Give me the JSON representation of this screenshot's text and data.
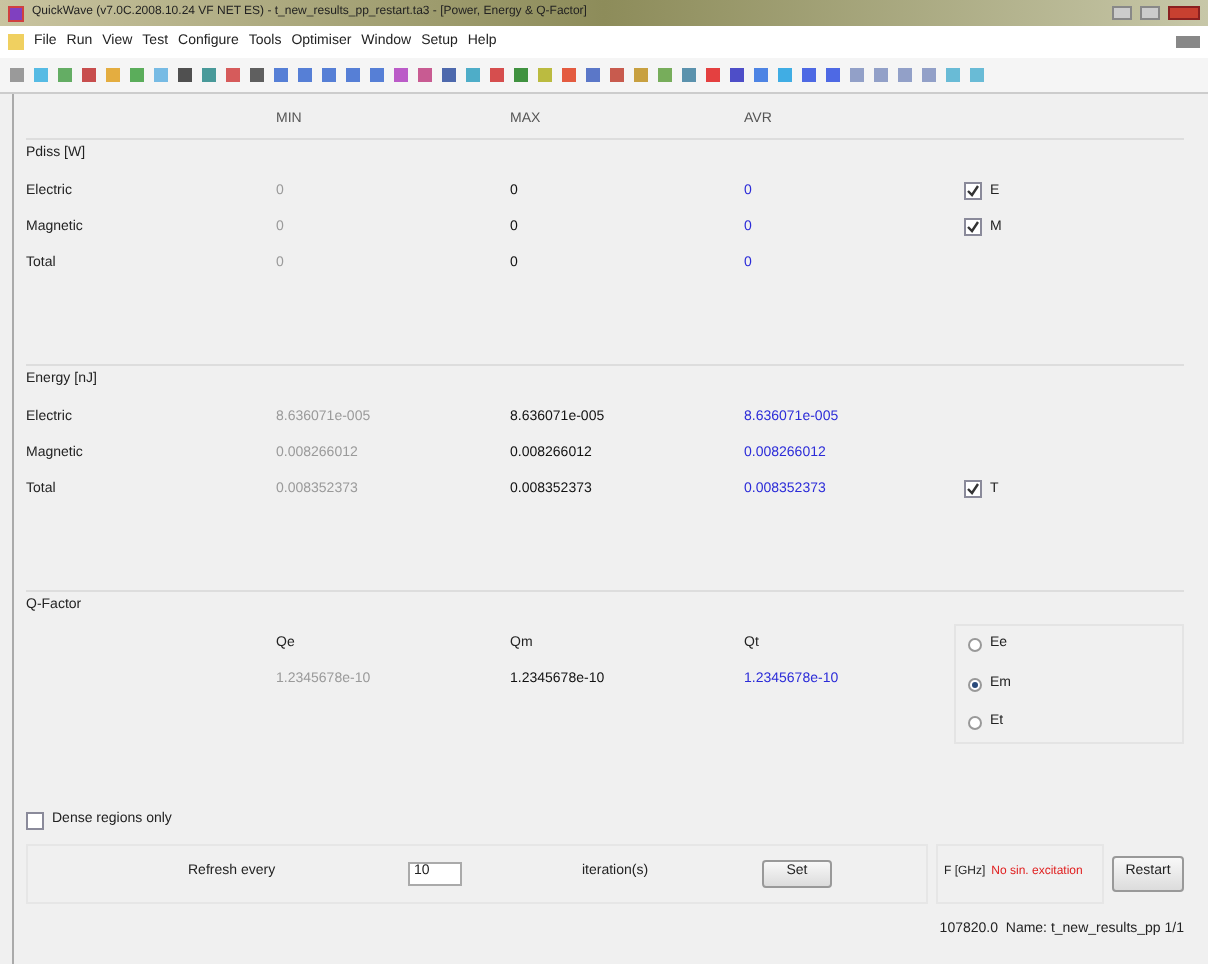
{
  "window": {
    "title": "QuickWave (v7.0C.2008.10.24 VF NET ES) - t_new_results_pp_restart.ta3 - [Power, Energy & Q-Factor]"
  },
  "menu": [
    {
      "label": "File"
    },
    {
      "label": "Run"
    },
    {
      "label": "View"
    },
    {
      "label": "Test"
    },
    {
      "label": "Configure"
    },
    {
      "label": "Tools"
    },
    {
      "label": "Optimiser"
    },
    {
      "label": "Window"
    },
    {
      "label": "Setup"
    },
    {
      "label": "Help"
    }
  ],
  "columns": [
    {
      "label": "MIN",
      "kind": "min"
    },
    {
      "label": "MAX",
      "kind": "max"
    },
    {
      "label": "AVR",
      "kind": "avr"
    }
  ],
  "sections": [
    {
      "title": "Pdiss [W]",
      "rows": [
        {
          "label": "Electric",
          "values": [
            "0",
            "0",
            "0"
          ],
          "checkbox": {
            "label": "E",
            "checked": true
          }
        },
        {
          "label": "Magnetic",
          "values": [
            "0",
            "0",
            "0"
          ],
          "checkbox": {
            "label": "M",
            "checked": true
          }
        },
        {
          "label": "Total",
          "values": [
            "0",
            "0",
            "0"
          ]
        }
      ]
    },
    {
      "title": "Energy [nJ]",
      "rows": [
        {
          "label": "Electric",
          "values": [
            "8.636071e-005",
            "8.636071e-005",
            "8.636071e-005"
          ]
        },
        {
          "label": "Magnetic",
          "values": [
            "0.008266012",
            "0.008266012",
            "0.008266012"
          ]
        },
        {
          "label": "Total",
          "values": [
            "0.008352373",
            "0.008352373",
            "0.008352373"
          ],
          "checkbox": {
            "label": "T",
            "checked": true
          }
        }
      ]
    }
  ],
  "qfactor": {
    "title": "Q-Factor",
    "headers": [
      "Qe",
      "Qm",
      "Qt"
    ],
    "values": [
      "1.2345678e-10",
      "1.2345678e-10",
      "1.2345678e-10"
    ],
    "radios": [
      {
        "label": "Ee",
        "selected": false
      },
      {
        "label": "Em",
        "selected": true
      },
      {
        "label": "Et",
        "selected": false
      }
    ]
  },
  "dense": {
    "label": "Dense regions only",
    "checked": false
  },
  "refresh": {
    "label": "Refresh every",
    "value": "10",
    "suffix": "iteration(s)",
    "button": "Set"
  },
  "frequency": {
    "label": "F [GHz]",
    "status": "No sin. excitation"
  },
  "restart": "Restart",
  "status_bar": "107820.0  Name: t_new_results_pp 1/1"
}
